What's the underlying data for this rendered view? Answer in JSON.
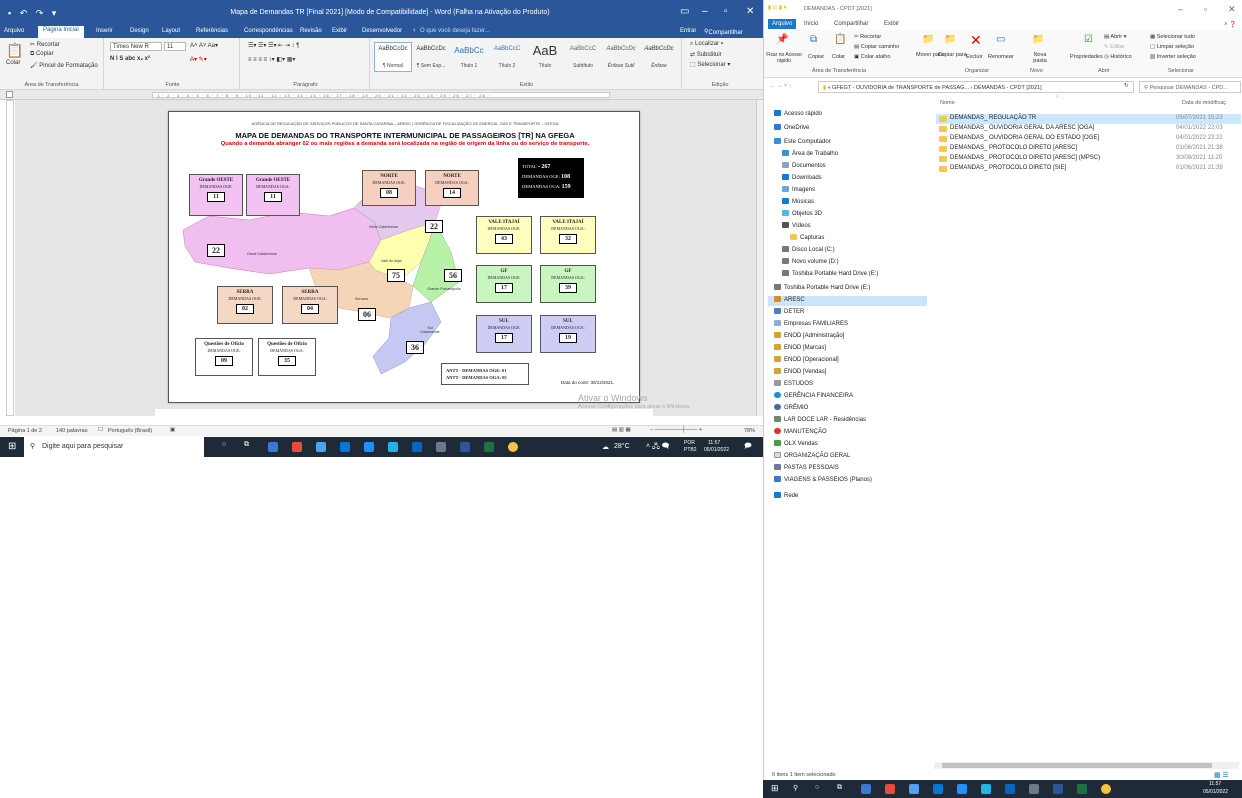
{
  "word": {
    "title": "Mapa de Demandas  TR [Final 2021] [Modo de Compatibilidade] - Word (Falha na Ativação do Produto)",
    "tabs": [
      "Arquivo",
      "Página Inicial",
      "Inserir",
      "Design",
      "Layout",
      "Referências",
      "Correspondências",
      "Revisão",
      "Exibir",
      "Desenvolvedor"
    ],
    "tell_me": "O que você deseja fazer...",
    "sign_in": "Entrar",
    "share": "Compartilhar",
    "clipboard": {
      "paste": "Colar",
      "cut": "Recortar",
      "copy": "Copiar",
      "painter": "Pincel de Formatação",
      "label": "Área de Transferência"
    },
    "font": {
      "name": "Times New R",
      "size": "11",
      "label": "Fonte"
    },
    "paragraph_label": "Parágrafo",
    "styles": [
      {
        "preview": "AaBbCcDc",
        "name": "¶ Normal"
      },
      {
        "preview": "AaBbCcDc",
        "name": "¶ Sem Esp..."
      },
      {
        "preview": "AaBbCc",
        "name": "Título 1"
      },
      {
        "preview": "AaBbCcC",
        "name": "Título 2"
      },
      {
        "preview": "AaB",
        "name": "Título"
      },
      {
        "preview": "AaBbCcC",
        "name": "Subtítulo"
      },
      {
        "preview": "AaBbCcDc",
        "name": "Ênfase Sutil"
      },
      {
        "preview": "AaBbCcDc",
        "name": "Ênfase"
      }
    ],
    "styles_label": "Estilo",
    "editing": {
      "find": "Localizar",
      "replace": "Substituir",
      "select": "Selecionar",
      "label": "Edição"
    },
    "status": {
      "page": "Página 1 de 2",
      "words": "140 palavras",
      "language": "Português (Brasil)",
      "zoom": "78%"
    }
  },
  "document": {
    "agency": "AGÊNCIA DE REGULAÇÃO DE SERVIÇOS PÚBLICOS DE SANTA CATARINA – ARESC | GERÊNCIA DE FISCALIZAÇÃO DE ENERGIA, GÁS E TRANSPORTE – GFEGA",
    "title": "MAPA DE DEMANDAS DO TRANSPORTE INTERMUNICIPAL DE PASSAGEIROS [TR] NA GFEGA",
    "subtitle": "Quando a demanda abranger 02 ou mais regiões a demanda será localizada na região de origem da linha ou do serviço de transporte.",
    "total": {
      "label": "TOTAL =",
      "value": "267",
      "oge_label": "DEMANDAS OGE:",
      "oge": "108",
      "oga_label": "DEMANDAS OGA:",
      "oga": "159"
    },
    "regions": [
      {
        "name": "Grande OESTE",
        "label": "DEMANDAS OGE:",
        "value": "11"
      },
      {
        "name": "Grande OESTE",
        "label": "DEMANDAS OGA:",
        "value": "11"
      },
      {
        "name": "NORTE",
        "label": "DEMANDAS OGE:",
        "value": "08"
      },
      {
        "name": "NORTE",
        "label": "DEMANDAS OGA:",
        "value": "14"
      },
      {
        "name": "VALE ITAJAÍ",
        "label": "DEMANDAS OGE:",
        "value": "43"
      },
      {
        "name": "VALE ITAJAÍ",
        "label": "DEMANDAS OGA:",
        "value": "32"
      },
      {
        "name": "GF",
        "label": "DEMANDAS OGE:",
        "value": "17"
      },
      {
        "name": "GF",
        "label": "DEMANDAS OGA:",
        "value": "39"
      },
      {
        "name": "SERRA",
        "label": "DEMANDAS OGE:",
        "value": "02"
      },
      {
        "name": "SERRA",
        "label": "DEMANDAS OGA:",
        "value": "04"
      },
      {
        "name": "SUL",
        "label": "DEMANDAS OGE:",
        "value": "17"
      },
      {
        "name": "SUL",
        "label": "DEMANDAS OGA:",
        "value": "19"
      },
      {
        "name": "Questões de Ofício",
        "label": "DEMANDAS OGE:",
        "value": "09"
      },
      {
        "name": "Questões de Ofício",
        "label": "DEMANDAS OGA:",
        "value": "35"
      }
    ],
    "map": [
      {
        "name": "Oeste Catarinense",
        "value": "22"
      },
      {
        "name": "Norte Catarinense",
        "value": "22"
      },
      {
        "name": "Vale do Itajaí",
        "value": "75"
      },
      {
        "name": "Grande Florianópolis",
        "value": "56"
      },
      {
        "name": "Serrana",
        "value": "06"
      },
      {
        "name": "Sul Catarinense",
        "value": "36"
      }
    ],
    "antt": {
      "line1_label": "ANTT - DEMANDAS OGE:",
      "line1": "01",
      "line2_label": "ANTT - DEMANDAS OGA:",
      "line2": "05"
    },
    "cut_date": "Data do corte: 30/12/2021."
  },
  "watermark": {
    "title": "Ativar o Windows",
    "sub": "Acesse Configurações para ativar o Windows."
  },
  "taskbar": {
    "search_placeholder": "Digite aqui para pesquisar",
    "weather": "28°C",
    "lang": "POR",
    "layout": "PTB2",
    "time": "11:57",
    "date": "05/01/2022"
  },
  "explorer": {
    "title": "DEMANDAS - CPDT [2021]",
    "tabs": [
      "Arquivo",
      "Início",
      "Compartilhar",
      "Exibir"
    ],
    "ribbon": {
      "pin": "Fixar no Acesso rápido",
      "copy": "Copiar",
      "paste": "Colar",
      "cut": "Recortar",
      "copy_path": "Copiar caminho",
      "paste_shortcut": "Colar atalho",
      "clipboard_label": "Área de Transferência",
      "move": "Mover para",
      "copy_to": "Copiar para",
      "delete": "Excluir",
      "rename": "Renomear",
      "organize_label": "Organizar",
      "new_folder": "Nova pasta",
      "new_label": "Novo",
      "properties": "Propriedades",
      "open": "Abrir",
      "edit": "Editar",
      "history": "Histórico",
      "open_label": "Abrir",
      "select_all": "Selecionar tudo",
      "select_none": "Limpar seleção",
      "invert": "Inverter seleção",
      "select_label": "Selecionar"
    },
    "address": "« GFEGT - OUVIDORIA de TRANSPORTE de PASSAG... › DEMANDAS - CPDT [2021]",
    "search_placeholder": "Pesquisar DEMANDAS - CPD...",
    "columns": {
      "name": "Nome",
      "date": "Data de modificaç"
    },
    "files": [
      {
        "name": "DEMANDAS_ REGULAÇÃO TR",
        "date": "05/07/2021 15:23"
      },
      {
        "name": "DEMANDAS_ OUVIDORIA GERAL DA ARESC [OGA]",
        "date": "04/01/2022 22:03"
      },
      {
        "name": "DEMANDAS_ OUVIDORIA GERAL DO ESTADO [OGE]",
        "date": "04/01/2022 23:22"
      },
      {
        "name": "DEMANDAS_ PROTOCOLO DIRETO [ARESC]",
        "date": "01/06/2021 21:38"
      },
      {
        "name": "DEMANDAS_ PROTOCOLO DIRETO [ARESC] (MPSC)",
        "date": "30/09/2021 11:20"
      },
      {
        "name": "DEMANDAS_ PROTOCOLO DIRETO [SIE]",
        "date": "01/06/2021 21:39"
      }
    ],
    "tree": [
      "Acesso rápido",
      "OneDrive",
      "Este Computador",
      "Área de Trabalho",
      "Documentos",
      "Downloads",
      "Imagens",
      "Músicas",
      "Objetos 3D",
      "Vídeos",
      "Capturas",
      "Disco Local (C:)",
      "Novo volume (D:)",
      "Toshiba Portable Hard Drive (E:)",
      "Toshiba Portable Hard Drive (E:)",
      "ARESC",
      "DETER",
      "Empresas FAMILIARES",
      "ENOD [Administração]",
      "ENOD [Marcas]",
      "ENOD [Operacional]",
      "ENOD [Vendas]",
      "ESTUDOS",
      "GERÊNCIA FINANCEIRA",
      "GRÊMIO",
      "LAR DOCE LAR - Residências",
      "MANUTENÇÃO",
      "OLX Vendas",
      "ORGANIZAÇÃO GERAL",
      "PASTAS PESSOAIS",
      "VIAGENS & PASSEIOS (Planos)",
      "Rede"
    ],
    "status": "6 itens   1 item selecionado",
    "time": "11:57",
    "date": "05/01/2022"
  }
}
